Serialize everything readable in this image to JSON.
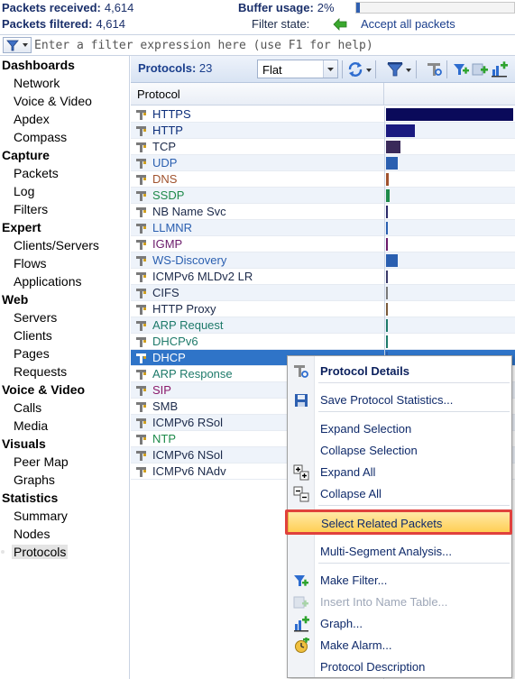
{
  "status": {
    "packets_received_label": "Packets received:",
    "packets_received_value": "4,614",
    "packets_filtered_label": "Packets filtered:",
    "packets_filtered_value": "4,614",
    "buffer_usage_label": "Buffer usage:",
    "buffer_usage_value": "2%",
    "buffer_usage_fraction": 0.02,
    "filter_state_label": "Filter state:",
    "filter_state_value": "Accept all packets"
  },
  "filter": {
    "placeholder": "Enter a filter expression here (use F1 for help)"
  },
  "nav": {
    "sections": [
      {
        "title": "Dashboards",
        "items": [
          "Network",
          "Voice & Video",
          "Apdex",
          "Compass"
        ]
      },
      {
        "title": "Capture",
        "items": [
          "Packets",
          "Log",
          "Filters"
        ]
      },
      {
        "title": "Expert",
        "items": [
          "Clients/Servers",
          "Flows",
          "Applications"
        ]
      },
      {
        "title": "Web",
        "items": [
          "Servers",
          "Clients",
          "Pages",
          "Requests"
        ]
      },
      {
        "title": "Voice & Video",
        "items": [
          "Calls",
          "Media"
        ]
      },
      {
        "title": "Visuals",
        "items": [
          "Peer Map",
          "Graphs"
        ]
      },
      {
        "title": "Statistics",
        "items": [
          "Summary",
          "Nodes",
          "Protocols"
        ]
      }
    ],
    "selected": "Protocols"
  },
  "toolbar": {
    "label": "Protocols:",
    "count": "23",
    "view_mode": "Flat"
  },
  "grid": {
    "column_protocol": "Protocol",
    "rows": [
      {
        "name": "HTTPS",
        "color": "#0b2d7a",
        "share": 1.0,
        "bar": "#0a0a5a"
      },
      {
        "name": "HTTP",
        "color": "#0b2d7a",
        "share": 0.23,
        "bar": "#1a1a80"
      },
      {
        "name": "TCP",
        "color": "#1c2a4a",
        "share": 0.11,
        "bar": "#3a2a5a"
      },
      {
        "name": "UDP",
        "color": "#2a5fb0",
        "share": 0.09,
        "bar": "#2a5fb0"
      },
      {
        "name": "DNS",
        "color": "#a0522d",
        "share": 0.02,
        "bar": "#a0522d"
      },
      {
        "name": "SSDP",
        "color": "#1e8a4a",
        "share": 0.03,
        "bar": "#1e8a4a"
      },
      {
        "name": "NB Name Svc",
        "color": "#1c2a4a",
        "share": 0.015,
        "bar": "#2a2a6a"
      },
      {
        "name": "LLMNR",
        "color": "#2a5fb0",
        "share": 0.01,
        "bar": "#2a5fb0"
      },
      {
        "name": "IGMP",
        "color": "#6a1a6a",
        "share": 0.01,
        "bar": "#6a1a6a"
      },
      {
        "name": "WS-Discovery",
        "color": "#2a5fb0",
        "share": 0.09,
        "bar": "#2a5fb0"
      },
      {
        "name": "ICMPv6 MLDv2 LR",
        "color": "#1c2a4a",
        "share": 0.008,
        "bar": "#3a3a6a"
      },
      {
        "name": "CIFS",
        "color": "#1c2a4a",
        "share": 0.008,
        "bar": "#7a7a7a"
      },
      {
        "name": "HTTP Proxy",
        "color": "#1c2a4a",
        "share": 0.008,
        "bar": "#7a5a3a"
      },
      {
        "name": "ARP Request",
        "color": "#1e7a6a",
        "share": 0.008,
        "bar": "#1e7a6a"
      },
      {
        "name": "DHCPv6",
        "color": "#1e7a6a",
        "share": 0.008,
        "bar": "#1e7a6a"
      },
      {
        "name": "DHCP",
        "color": "#ffffff",
        "share": 0.008,
        "bar": "#2a5fb0"
      },
      {
        "name": "ARP Response",
        "color": "#1e7a6a",
        "share": 0.008,
        "bar": "#1e7a6a"
      },
      {
        "name": "SIP",
        "color": "#8a1a6a",
        "share": 0.008,
        "bar": "#8a1a6a"
      },
      {
        "name": "SMB",
        "color": "#1c2a4a",
        "share": 0.008,
        "bar": "#7a7a7a"
      },
      {
        "name": "ICMPv6 RSol",
        "color": "#1c2a4a",
        "share": 0.008,
        "bar": "#3a3a6a"
      },
      {
        "name": "NTP",
        "color": "#1e8a4a",
        "share": 0.008,
        "bar": "#1e8a4a"
      },
      {
        "name": "ICMPv6 NSol",
        "color": "#1c2a4a",
        "share": 0.008,
        "bar": "#3a3a6a"
      },
      {
        "name": "ICMPv6 NAdv",
        "color": "#1c2a4a",
        "share": 0.008,
        "bar": "#3a3a6a"
      }
    ],
    "selected_row": "DHCP"
  },
  "context_menu": {
    "items": [
      {
        "label": "Protocol Details",
        "icon": "protocol-details-icon",
        "bold": true
      },
      {
        "label": "Save Protocol Statistics...",
        "icon": "save-icon"
      },
      {
        "label": "Expand Selection",
        "icon": ""
      },
      {
        "label": "Collapse Selection",
        "icon": ""
      },
      {
        "label": "Expand All",
        "icon": "expand-all-icon"
      },
      {
        "label": "Collapse All",
        "icon": "collapse-all-icon"
      },
      {
        "label": "Select Related Packets",
        "icon": "",
        "highlighted": true
      },
      {
        "label": "Multi-Segment Analysis...",
        "icon": ""
      },
      {
        "label": "Make Filter...",
        "icon": "make-filter-icon"
      },
      {
        "label": "Insert Into Name Table...",
        "icon": "insert-name-table-icon",
        "disabled": true
      },
      {
        "label": "Graph...",
        "icon": "graph-icon"
      },
      {
        "label": "Make Alarm...",
        "icon": "alarm-icon"
      },
      {
        "label": "Protocol Description",
        "icon": ""
      }
    ]
  },
  "colors": {
    "accent": "#2f74c8",
    "highlight": "#ffcf55",
    "callout": "#e0413c"
  }
}
